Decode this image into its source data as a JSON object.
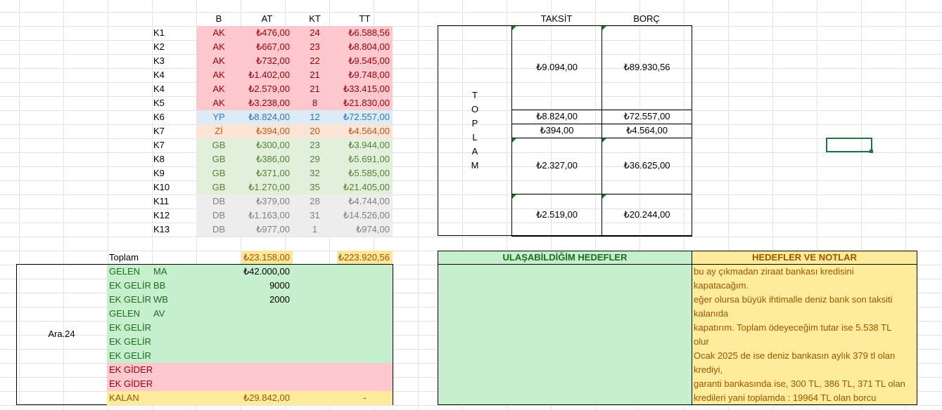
{
  "colors": {
    "ak_bg": "#ffc7ce",
    "ak_fg": "#9c0006",
    "yp_bg": "#ddebf7",
    "yp_fg": "#2f75b5",
    "zi_bg": "#fce4d6",
    "zi_fg": "#c65911",
    "gb_bg": "#e2efda",
    "gb_fg": "#548235",
    "db_bg": "#ededed",
    "db_fg": "#7f7f7f",
    "green_block": "#c6efce",
    "pink_block": "#ffc7ce",
    "yellow": "#ffeb9c",
    "gold": "#ffe699"
  },
  "headers": {
    "b": "B",
    "at": "AT",
    "kt": "KT",
    "tt": "TT",
    "taksit": "TAKSİT",
    "borc": "BORÇ"
  },
  "loans": [
    {
      "k": "K1",
      "b": "AK",
      "at": "₺476,00",
      "kt": "24",
      "tt": "₺6.588,56",
      "group": "ak"
    },
    {
      "k": "K2",
      "b": "AK",
      "at": "₺667,00",
      "kt": "23",
      "tt": "₺8.804,00",
      "group": "ak"
    },
    {
      "k": "K3",
      "b": "AK",
      "at": "₺732,00",
      "kt": "22",
      "tt": "₺9.545,00",
      "group": "ak"
    },
    {
      "k": "K4",
      "b": "AK",
      "at": "₺1.402,00",
      "kt": "21",
      "tt": "₺9.748,00",
      "group": "ak"
    },
    {
      "k": "K4",
      "b": "AK",
      "at": "₺2.579,00",
      "kt": "21",
      "tt": "₺33.415,00",
      "group": "ak"
    },
    {
      "k": "K5",
      "b": "AK",
      "at": "₺3.238,00",
      "kt": "8",
      "tt": "₺21.830,00",
      "group": "ak"
    },
    {
      "k": "K6",
      "b": "YP",
      "at": "₺8.824,00",
      "kt": "12",
      "tt": "₺72.557,00",
      "group": "yp"
    },
    {
      "k": "K7",
      "b": "Zİ",
      "at": "₺394,00",
      "kt": "20",
      "tt": "₺4.564,00",
      "group": "zi"
    },
    {
      "k": "K7",
      "b": "GB",
      "at": "₺300,00",
      "kt": "23",
      "tt": "₺3.944,00",
      "group": "gb"
    },
    {
      "k": "K8",
      "b": "GB",
      "at": "₺386,00",
      "kt": "29",
      "tt": "₺5.691,00",
      "group": "gb"
    },
    {
      "k": "K9",
      "b": "GB",
      "at": "₺371,00",
      "kt": "32",
      "tt": "₺5.585,00",
      "group": "gb"
    },
    {
      "k": "K10",
      "b": "GB",
      "at": "₺1.270,00",
      "kt": "35",
      "tt": "₺21.405,00",
      "group": "gb"
    },
    {
      "k": "K11",
      "b": "DB",
      "at": "₺379,00",
      "kt": "28",
      "tt": "₺4.744,00",
      "group": "db"
    },
    {
      "k": "K12",
      "b": "DB",
      "at": "₺1.163,00",
      "kt": "31",
      "tt": "₺14.526,00",
      "group": "db"
    },
    {
      "k": "K13",
      "b": "DB",
      "at": "₺977,00",
      "kt": "1",
      "tt": "₺974,00",
      "group": "db"
    }
  ],
  "toplam_row": {
    "label": "Toplam",
    "at": "₺23.158,00",
    "tt": "₺223.920,56"
  },
  "summary": {
    "vertical_label": [
      "T",
      "O",
      "P",
      "L",
      "A",
      "M"
    ],
    "rows": [
      {
        "taksit": "₺9.094,00",
        "borc": "₺89.930,56"
      },
      {
        "taksit": "₺8.824,00",
        "borc": "₺72.557,00"
      },
      {
        "taksit": "₺394,00",
        "borc": "₺4.564,00"
      },
      {
        "taksit": "₺2.327,00",
        "borc": "₺36.625,00"
      },
      {
        "taksit": "₺2.519,00",
        "borc": "₺20.244,00"
      }
    ]
  },
  "budget": {
    "month": "Ara.24",
    "rows": [
      {
        "a": "GELEN",
        "b": "MA",
        "v": "₺42.000,00",
        "kind": "green"
      },
      {
        "a": "EK GELİR",
        "b": "BB",
        "v": "9000",
        "kind": "green"
      },
      {
        "a": "EK GELİR",
        "b": "WB",
        "v": "2000",
        "kind": "green"
      },
      {
        "a": "GELEN",
        "b": "AV",
        "v": "",
        "kind": "green"
      },
      {
        "a": "EK GELİR",
        "b": "",
        "v": "",
        "kind": "green"
      },
      {
        "a": "EK GELİR",
        "b": "",
        "v": "",
        "kind": "green"
      },
      {
        "a": "EK GELİR",
        "b": "",
        "v": "",
        "kind": "green"
      },
      {
        "a": "EK GİDER",
        "b": "",
        "v": "",
        "kind": "pink"
      },
      {
        "a": "EK GİDER",
        "b": "",
        "v": "",
        "kind": "pink"
      },
      {
        "a": "KALAN",
        "b": "",
        "v": "₺29.842,00",
        "dash": "-",
        "kind": "yellow"
      }
    ]
  },
  "goals": {
    "title": "ULAŞABİLDİĞİM HEDEFLER"
  },
  "notes": {
    "title": "HEDEFLER VE NOTLAR",
    "lines": [
      "bu ay çıkmadan ziraat bankası kredisini",
      "kapatacağım.",
      "eğer olursa büyük ihtimalle deniz bank son taksiti",
      "kalanıda",
      "kapatırım.  Toplam ödeyeceğim tutar ise 5.538 TL",
      "olur",
      "Ocak 2025 de ise deniz bankasın aylık 379 tl olan",
      "krediyi,",
      "garanti bankasında ise, 300 TL, 386 TL, 371 TL olan",
      "kredileri yani toplamda : 19964 TL olan borcu"
    ]
  }
}
